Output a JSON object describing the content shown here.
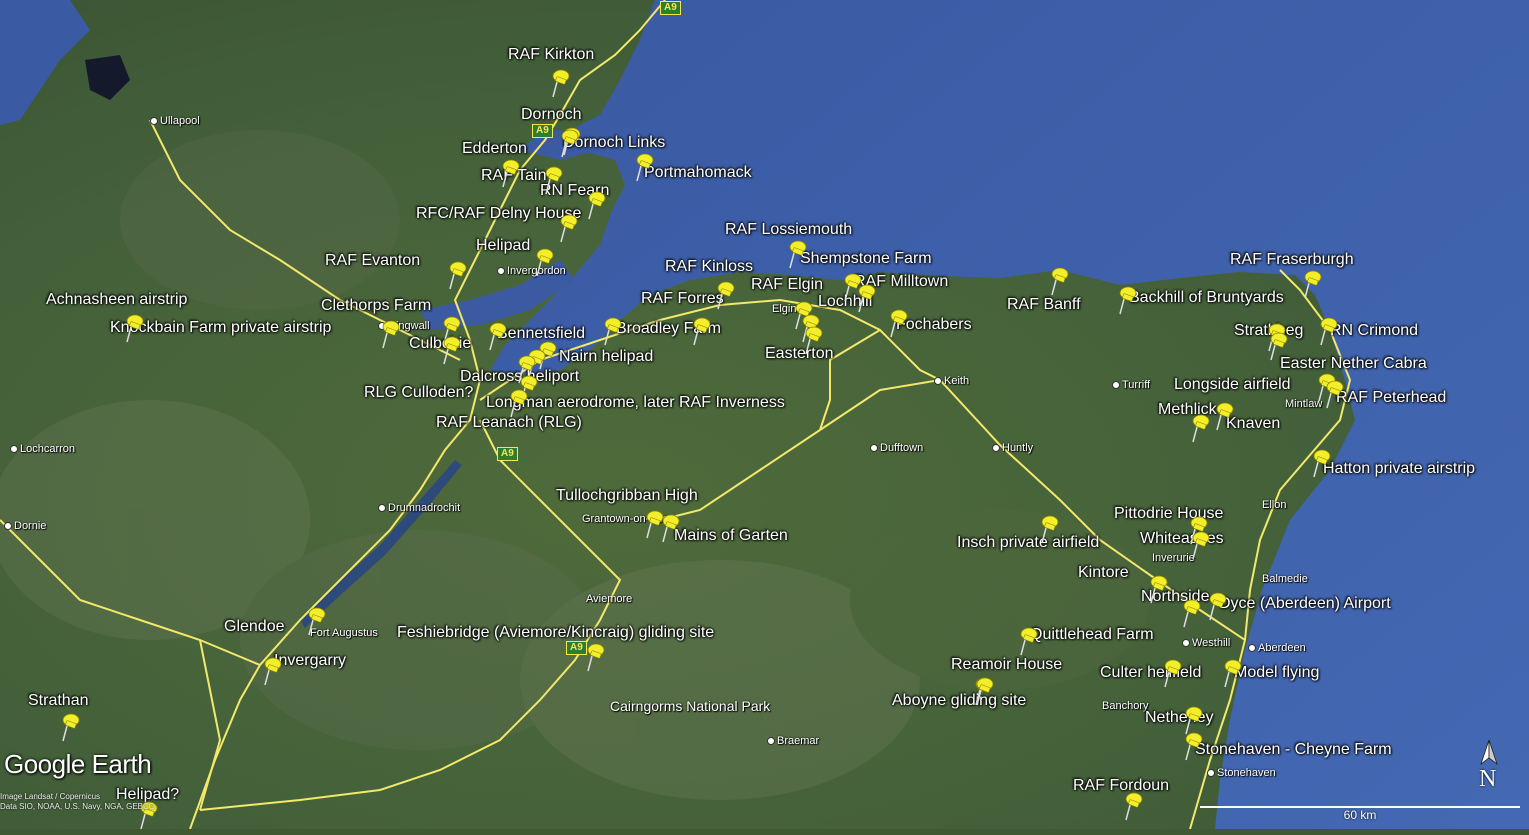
{
  "brand": "Google Earth",
  "attribution": [
    "Image Landsat / Copernicus",
    "Data SIO, NOAA, U.S. Navy, NGA, GEBCO"
  ],
  "north_label": "N",
  "scale_label": "60 km",
  "colors": {
    "sea": "#3d5fa8",
    "land": "#45613a",
    "road": "#f2e86a",
    "pin": "#f2ee2a"
  },
  "road_shields": [
    "A9",
    "A9",
    "A9",
    "A9"
  ],
  "towns": [
    "Ullapool",
    "Invergordon",
    "Dingwall",
    "Elgin",
    "Keith",
    "Turriff",
    "Mintlaw",
    "Lochcarron",
    "Dornie",
    "Drumnadrochit",
    "Dufftown",
    "Huntly",
    "Grantown-on-Spey",
    "Aviemore",
    "Fort Augustus",
    "Cairngorms National Park",
    "Braemar",
    "Ellon",
    "Balmedie",
    "Inverurie",
    "Westhill",
    "Aberdeen",
    "Banchory",
    "Stonehaven",
    "Fraserburgh",
    "Lochhill"
  ],
  "sites": [
    "RAF Kirkton",
    "Dornoch",
    "Dornoch Links",
    "Edderton",
    "RAF Tain",
    "Portmahomack",
    "RN Fearn",
    "RFC/RAF Delny House",
    "Helipad",
    "RAF Evanton",
    "RAF Lossiemouth",
    "Shempstone Farm",
    "RAF Kinloss",
    "RAF Elgin",
    "RAF Milltown",
    "RAF Forres",
    "Lochhill",
    "Achnasheen airstrip",
    "Clethorps Farm",
    "Knockbain Farm private airstrip",
    "Culbokie",
    "Bennetsfield",
    "Broadley Farm",
    "Nairn helipad",
    "Fochabers",
    "Easterton",
    "Dalcross heliport",
    "RLG Culloden?",
    "Longman aerodrome, later RAF Inverness",
    "RAF Leanach (RLG)",
    "RAF Banff",
    "Backhill of Bruntyards",
    "RAF Fraserburgh",
    "Strathbeg",
    "RN Crimond",
    "Easter Nether Cabra",
    "Longside airfield",
    "RAF Peterhead",
    "Methlick",
    "Knaven",
    "Hatton private airstrip",
    "Tullochgribban High",
    "Mains of Garten",
    "Pittodrie House",
    "Insch private airfield",
    "Whiteashes",
    "Kintore",
    "Northside",
    "Dyce (Aberdeen) Airport",
    "Glendoe",
    "Feshiebridge (Aviemore/Kincraig) gliding site",
    "Invergarry",
    "Quittlehead Farm",
    "Reamoir House",
    "Culter helifield",
    "Model flying",
    "Aboyne gliding site",
    "Netherley",
    "Strathan",
    "Stonehaven - Cheyne Farm",
    "RAF Fordoun",
    "Helipad?"
  ]
}
